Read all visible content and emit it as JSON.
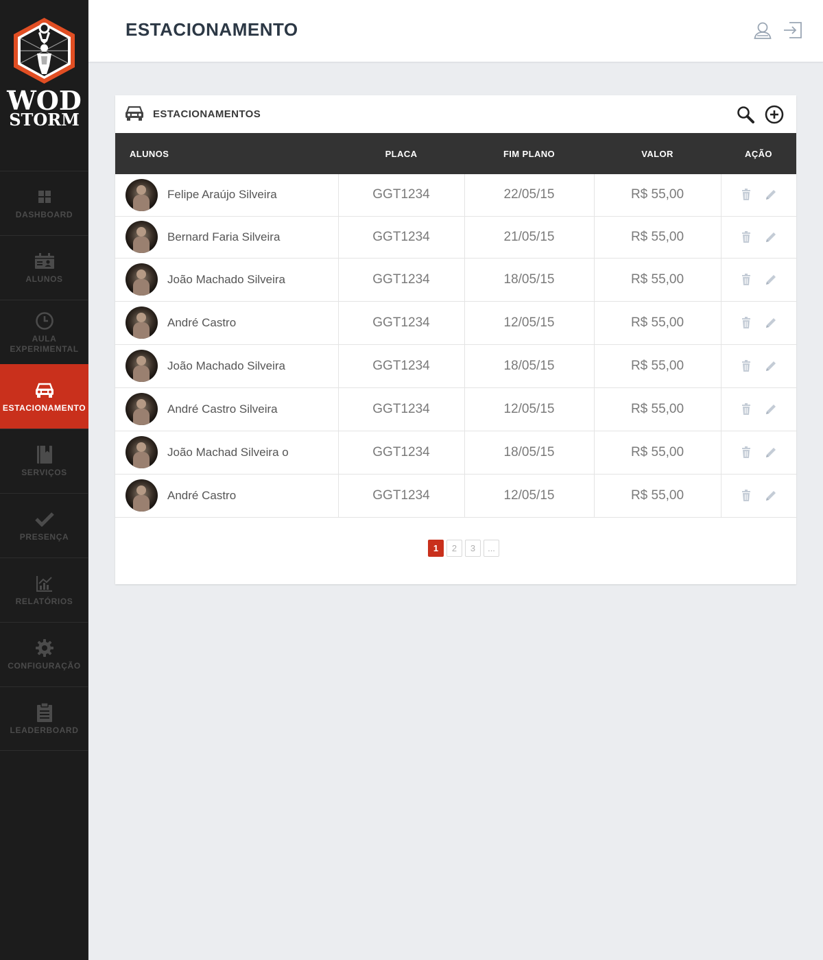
{
  "brand": {
    "line1": "WOD",
    "line2": "STORM"
  },
  "sidebar": {
    "items": [
      {
        "label": "DASHBOARD",
        "icon": "dashboard-icon",
        "active": false
      },
      {
        "label": "ALUNOS",
        "icon": "id-card-icon",
        "active": false
      },
      {
        "label": "AULA EXPERIMENTAL",
        "icon": "clock-icon",
        "active": false
      },
      {
        "label": "ESTACIONAMENTO",
        "icon": "car-icon",
        "active": true
      },
      {
        "label": "SERVIÇOS",
        "icon": "book-icon",
        "active": false
      },
      {
        "label": "PRESENÇA",
        "icon": "check-icon",
        "active": false
      },
      {
        "label": "RELATÓRIOS",
        "icon": "chart-icon",
        "active": false
      },
      {
        "label": "CONFIGURAÇÃO",
        "icon": "gear-icon",
        "active": false
      },
      {
        "label": "LEADERBOARD",
        "icon": "clipboard-icon",
        "active": false
      }
    ]
  },
  "header": {
    "title": "ESTACIONAMENTO",
    "icons": [
      "user-icon",
      "logout-icon"
    ]
  },
  "card": {
    "title": "ESTACIONAMENTOS",
    "icons": [
      "car-icon",
      "search-icon",
      "add-circle-icon"
    ]
  },
  "table": {
    "columns": [
      "ALUNOS",
      "PLACA",
      "FIM PLANO",
      "VALOR",
      "AÇÃO"
    ],
    "rows": [
      {
        "name": "Felipe Araújo Silveira",
        "placa": "GGT1234",
        "fim": "22/05/15",
        "valor": "R$ 55,00"
      },
      {
        "name": "Bernard Faria Silveira",
        "placa": "GGT1234",
        "fim": "21/05/15",
        "valor": "R$ 55,00"
      },
      {
        "name": "João Machado Silveira",
        "placa": "GGT1234",
        "fim": "18/05/15",
        "valor": "R$ 55,00"
      },
      {
        "name": "André Castro",
        "placa": "GGT1234",
        "fim": "12/05/15",
        "valor": "R$ 55,00"
      },
      {
        "name": "João Machado Silveira",
        "placa": "GGT1234",
        "fim": "18/05/15",
        "valor": "R$ 55,00"
      },
      {
        "name": "André Castro Silveira",
        "placa": "GGT1234",
        "fim": "12/05/15",
        "valor": "R$ 55,00"
      },
      {
        "name": "João Machad Silveira o",
        "placa": "GGT1234",
        "fim": "18/05/15",
        "valor": "R$ 55,00"
      },
      {
        "name": "André Castro",
        "placa": "GGT1234",
        "fim": "12/05/15",
        "valor": "R$ 55,00"
      }
    ],
    "row_icons": [
      "trash-icon",
      "pencil-icon"
    ]
  },
  "pagination": {
    "pages": [
      "1",
      "2",
      "3",
      "..."
    ],
    "current": "1"
  },
  "colors": {
    "accent": "#c9301c",
    "sidebar": "#1c1c1c",
    "table_header": "#333333",
    "title": "#2c3845"
  }
}
